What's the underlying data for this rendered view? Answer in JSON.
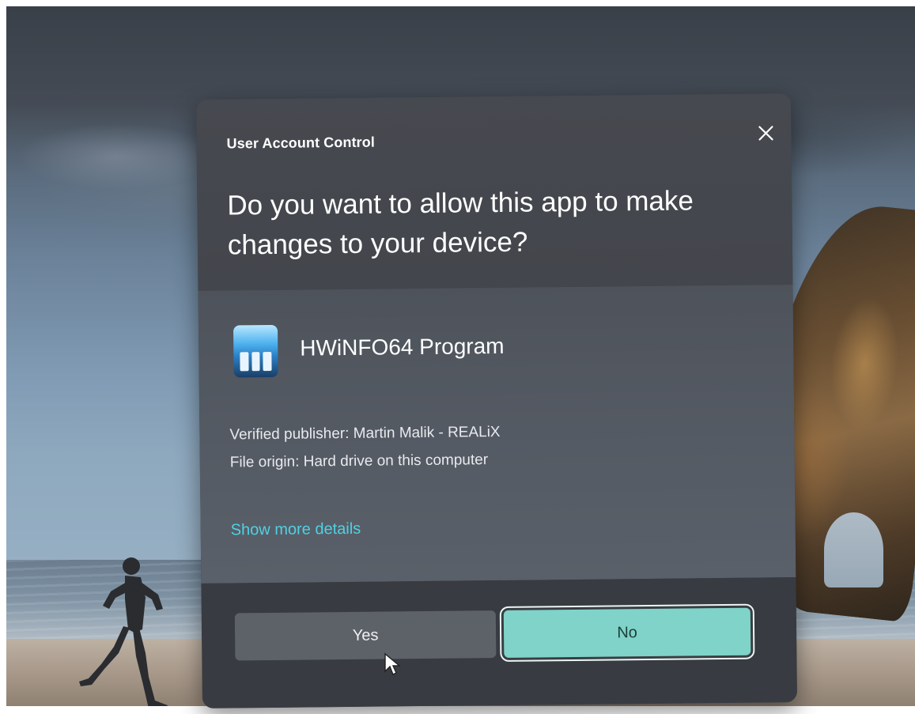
{
  "dialog": {
    "window_title": "User Account Control",
    "question": "Do you want to allow this app to make changes to your device?",
    "app_name": "HWiNFO64 Program",
    "publisher_line": "Verified publisher: Martin Malik - REALiX",
    "origin_line": "File origin: Hard drive on this computer",
    "details_link": "Show more details",
    "yes_label": "Yes",
    "no_label": "No",
    "close_icon": "close-icon",
    "app_icon": "hwinfo-app-icon"
  },
  "colors": {
    "dialog_bg": "#3f4248",
    "link": "#4fd1e4",
    "no_button": "#7fd3c9",
    "yes_button": "#5d6168"
  }
}
